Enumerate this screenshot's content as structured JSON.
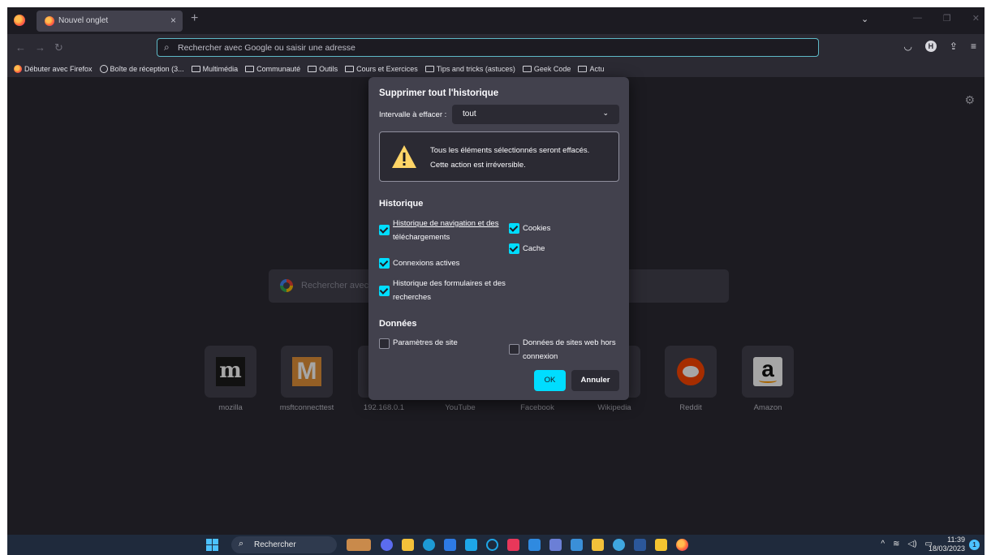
{
  "browser": {
    "tab_title": "Nouvel onglet",
    "tab_close": "×",
    "new_tab": "+",
    "tabs_list": "⌄",
    "window_controls": {
      "minimize": "—",
      "restore": "❐",
      "close": "✕"
    },
    "nav": {
      "back": "←",
      "forward": "→",
      "reload": "↻"
    },
    "url_placeholder": "Rechercher avec Google ou saisir une adresse",
    "toolbar_icons": [
      "pocket-icon",
      "account-icon",
      "extensions-icon",
      "menu-icon"
    ],
    "account_initial": "H",
    "share_glyph": "⇪",
    "menu_glyph": "≡",
    "pocket_glyph": "◡"
  },
  "bookmarks": [
    {
      "label": "Débuter avec Firefox",
      "icon": "firefox-icon"
    },
    {
      "label": "Boîte de réception (3...",
      "icon": "globe-icon"
    },
    {
      "label": "Multimédia",
      "icon": "folder-icon"
    },
    {
      "label": "Communauté",
      "icon": "folder-icon"
    },
    {
      "label": "Outils",
      "icon": "folder-icon"
    },
    {
      "label": "Cours et Exercices",
      "icon": "folder-icon"
    },
    {
      "label": "Tips and tricks (astuces)",
      "icon": "folder-icon"
    },
    {
      "label": "Geek Code",
      "icon": "folder-icon"
    },
    {
      "label": "Actu",
      "icon": "folder-icon"
    }
  ],
  "newtab": {
    "search_placeholder": "Rechercher avec",
    "settings_glyph": "⚙",
    "shortcuts": [
      {
        "label": "mozilla",
        "logo": "m"
      },
      {
        "label": "msftconnecttest",
        "logo": "M"
      },
      {
        "label": "192.168.0.1"
      },
      {
        "label": "YouTube"
      },
      {
        "label": "Facebook"
      },
      {
        "label": "Wikipedia"
      },
      {
        "label": "Reddit"
      },
      {
        "label": "Amazon",
        "logo": "a"
      }
    ]
  },
  "dialog": {
    "title": "Supprimer tout l'historique",
    "range_label": "Intervalle à effacer :",
    "range_value": "tout",
    "range_chevron": "⌄",
    "warning_line1": "Tous les éléments sélectionnés seront effacés.",
    "warning_line2": "Cette action est irréversible.",
    "history_title": "Historique",
    "history_items": [
      {
        "label_line1": "Historique de navigation et des",
        "label_line2": "téléchargements",
        "checked": true
      },
      {
        "label_line1": "Connexions actives",
        "checked": true
      },
      {
        "label_line1": "Historique des formulaires et des",
        "label_line2": "recherches",
        "checked": true
      },
      {
        "label_line1": "Cookies",
        "checked": true
      },
      {
        "label_line1": "Cache",
        "checked": true
      }
    ],
    "data_title": "Données",
    "data_items": [
      {
        "label_line1": "Paramètres de site",
        "checked": false
      },
      {
        "label_line1": "Données de sites web hors",
        "label_line2": "connexion",
        "checked": false
      }
    ],
    "ok_label": "OK",
    "cancel_label": "Annuler",
    "accent": "#00ddff"
  },
  "taskbar": {
    "search_label": "Rechercher",
    "search_glyph": "🔍",
    "tray": {
      "chevron": "^",
      "wifi": "≋",
      "volume": "◁)",
      "battery": "▭"
    },
    "time": "11:39",
    "date": "18/03/2023",
    "notification_count": "1",
    "accent": "#4cc2ff"
  }
}
